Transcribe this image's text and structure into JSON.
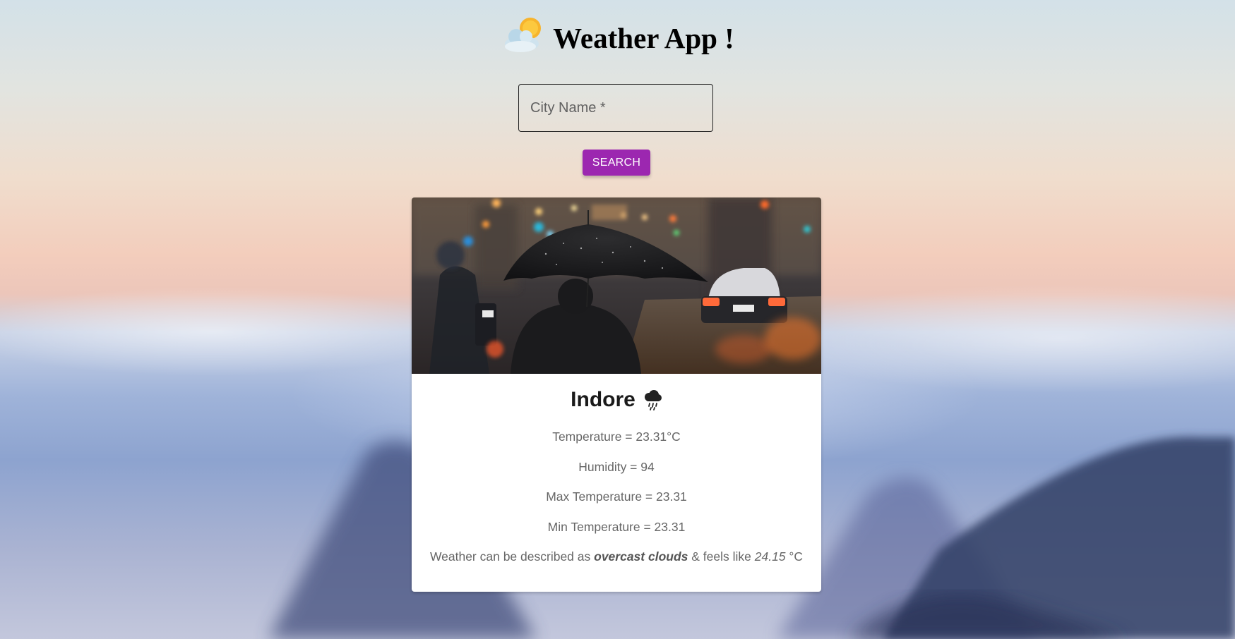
{
  "app": {
    "title": "Weather App !",
    "logo_icon": "sun-behind-cloud-icon"
  },
  "search": {
    "placeholder": "City Name *",
    "value": "",
    "button_label": "SEARCH"
  },
  "colors": {
    "accent": "#9c27b0",
    "card_background": "#ffffff"
  },
  "weather": {
    "city": "Indore",
    "condition_icon": "rain-cloud-icon",
    "temperature_label": "Temperature = 23.31°C",
    "humidity_label": "Humidity = 94",
    "max_temp_label": "Max Temperature = 23.31",
    "min_temp_label": "Min Temperature = 23.31",
    "description_prefix": "Weather can be described as",
    "description": "overcast clouds",
    "feels_like_prefix": "& feels like",
    "feels_like": "24.15",
    "feels_like_unit": "°C"
  }
}
